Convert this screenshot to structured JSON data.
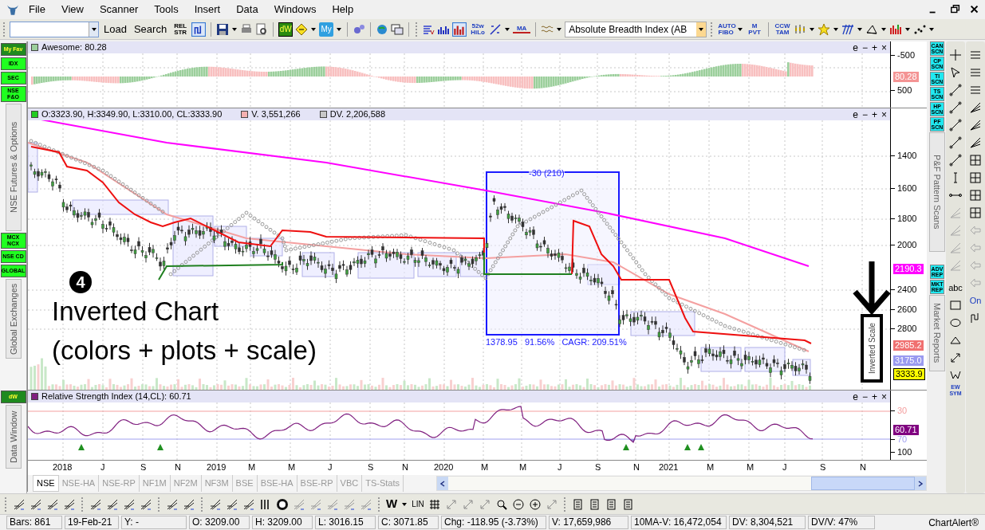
{
  "menu": [
    "File",
    "View",
    "Scanner",
    "Tools",
    "Insert",
    "Data",
    "Windows",
    "Help"
  ],
  "toolbar": {
    "load": "Load",
    "search": "Search",
    "rel_str": "REL STR",
    "dw": "dW",
    "my": "My",
    "hilo": "52w HiLo",
    "ma": "MA",
    "indicator_select": "Absolute Breadth Index (AB",
    "auto_fibo": "AUTO FIBO",
    "m_pvt": "M PVT",
    "ccw_tam": "CCW TAM"
  },
  "left_panel": [
    {
      "buttons": [
        "My Fav",
        "IDX",
        "SEC",
        "NSE F&O"
      ],
      "title": "NSE Futures & Options"
    },
    {
      "buttons": [
        "MCX NCX",
        "NSE CD",
        "GLOBAL"
      ],
      "title": "Global Exchanges"
    },
    {
      "buttons": [
        "dW"
      ],
      "title": "Data Window"
    }
  ],
  "awesome_pane": {
    "legend": "Awesome: 80.28",
    "controls": [
      "e",
      "−",
      "+",
      "×"
    ],
    "axis": [
      "-500",
      "500"
    ],
    "value_tag": "80.28"
  },
  "price_pane": {
    "legend": [
      {
        "text": "O:3323.90, H:3349.90, L:3310.00, CL:3333.90",
        "color": "#22cc22"
      },
      {
        "text": "V. 3,551,266",
        "color": "#f4b0b0"
      },
      {
        "text": "DV. 2,206,588",
        "color": "#c8c8c8"
      }
    ],
    "controls": [
      "e",
      "−",
      "+",
      "×"
    ],
    "axis": [
      "1400",
      "1600",
      "1800",
      "2000",
      "2400",
      "2600",
      "2800"
    ],
    "value_tags": [
      {
        "text": "2190.3",
        "color": "#ff00ff"
      },
      {
        "text": "2985.2",
        "color": "#f07070"
      },
      {
        "text": "3175.0",
        "color": "#9a9af0"
      },
      {
        "text": "3333.9",
        "color": "#ffff00"
      }
    ],
    "badge": "4",
    "title": "Inverted Chart",
    "subtitle": "(colors + plots + scale)",
    "scale_note": "Inverted Scale",
    "box_label": "-30 (210)",
    "box_stats": "1378.95   91.56%   CAGR: 209.51%"
  },
  "rsi_pane": {
    "legend": "Relative Strength Index (14,CL): 60.71",
    "controls": [
      "e",
      "−",
      "+",
      "×"
    ],
    "axis": [
      "30",
      "70",
      "100"
    ],
    "value_tag": "60.71"
  },
  "x_axis": [
    "2018",
    "J",
    "S",
    "N",
    "2019",
    "M",
    "M",
    "J",
    "S",
    "N",
    "2020",
    "M",
    "M",
    "J",
    "S",
    "N",
    "2021",
    "M",
    "M",
    "J",
    "S",
    "N"
  ],
  "tabs": [
    {
      "label": "NSE",
      "selected": true
    },
    {
      "label": "NSE-HA",
      "selected": false
    },
    {
      "label": "NSE-RP",
      "selected": false
    },
    {
      "label": "NF1M",
      "selected": false
    },
    {
      "label": "NF2M",
      "selected": false
    },
    {
      "label": "NF3M",
      "selected": false
    },
    {
      "label": "BSE",
      "selected": false
    },
    {
      "label": "BSE-HA",
      "selected": false
    },
    {
      "label": "BSE-RP",
      "selected": false
    },
    {
      "label": "VBC",
      "selected": false
    },
    {
      "label": "TS-Stats",
      "selected": false
    }
  ],
  "side_panel": {
    "scans": [
      "CAN SCN",
      "CP SCN",
      "TI SCN",
      "TS SCN",
      "HP SCN",
      "PF SCN"
    ],
    "scans_title": "P&F Pattern Scans",
    "reports": [
      "ADV REP",
      "MKT REP"
    ],
    "reports_title": "Market Reports"
  },
  "drawing_tools": {
    "abc": "abc",
    "ew_sym": "EW SYM",
    "on": "On"
  },
  "bottom_toolbar": {
    "w": "W",
    "lin": "LIN"
  },
  "status_bar": [
    "Bars: 861",
    "19-Feb-21",
    "Y: -",
    "O: 3209.00",
    "H: 3209.00",
    "L: 3016.15",
    "C: 3071.85",
    "Chg: -118.95 (-3.73%)",
    "V: 17,659,986",
    "10MA-V: 16,472,054",
    "DV: 8,304,521",
    "DV/V: 47%",
    "ChartAlert®"
  ]
}
